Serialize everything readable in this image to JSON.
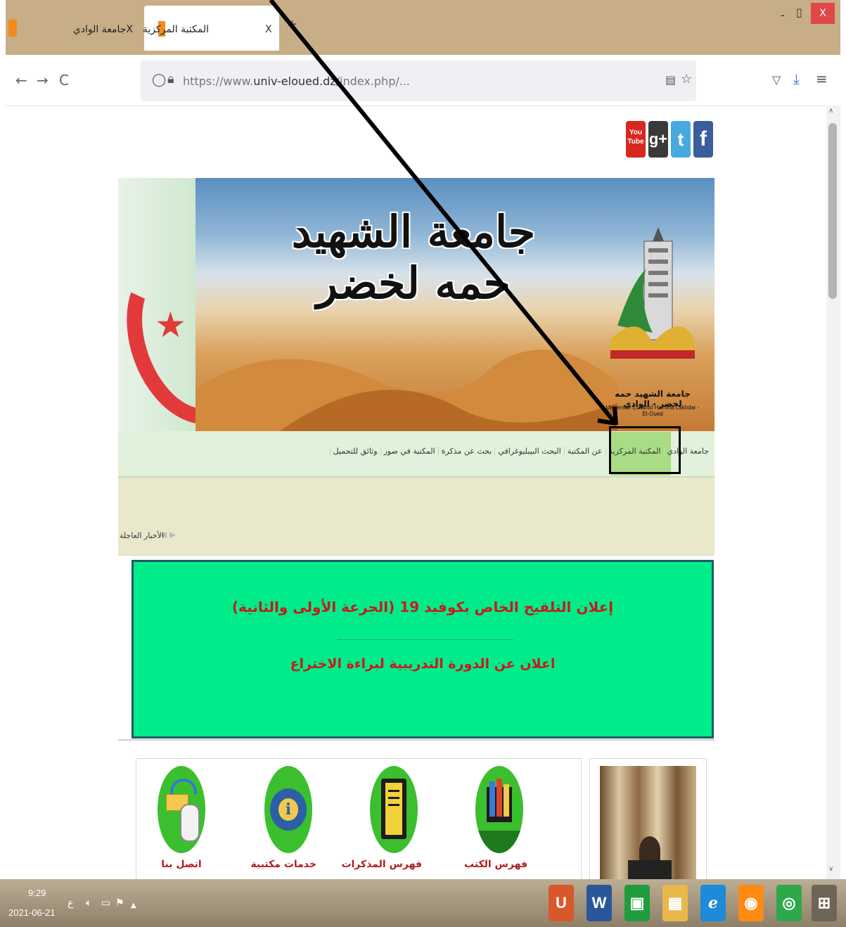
{
  "browser": {
    "tabs": [
      {
        "title": "Xجامعة الوادي",
        "active": false
      },
      {
        "title": "المكتبة المركزية",
        "active": true,
        "close": "X"
      }
    ],
    "new_tab": "+",
    "window_controls": {
      "minimize": "-",
      "maximize": "▯",
      "close": "X"
    },
    "nav": {
      "back": "←",
      "forward": "→",
      "reload": "C"
    },
    "url_prefix": "https://www.",
    "url_domain": "univ-eloued.dz",
    "url_path": "/index.php/...",
    "colors": {
      "titlebar": "#c7ae86",
      "close": "#e04848"
    }
  },
  "page": {
    "social": [
      {
        "name": "youtube",
        "label": "You Tube",
        "color": "#d6281f"
      },
      {
        "name": "google-plus",
        "label": "g+",
        "color": "#3a3a3a"
      },
      {
        "name": "twitter",
        "label": "t",
        "color": "#48a9e0"
      },
      {
        "name": "facebook",
        "label": "f",
        "color": "#3b5d9e"
      }
    ],
    "banner": {
      "title": "جامعة الشهيد حمه لخضر",
      "logo_ar": "جامعة الشهيد حمه لخضر - الوادي",
      "logo_fr": "Université Echahid Hamma Lakhdar - El-Oued"
    },
    "menu": [
      "جامعة الوادي",
      "المكتبة المركزية",
      "عن المكتبة",
      "البحث البيبليوغرافي",
      "بحث عن مذكرة",
      "المكتبة في صور",
      "وثائق للتحميل"
    ],
    "menu_active_index": 1,
    "ticker": {
      "label": "الأخبار العاجلة",
      "arrows": "◀ ▶"
    },
    "announcements": [
      "إعلان التلقيح الخاص بكوفيد 19 (الجرعة الأولى والثانية)",
      "اعلان عن الدورة التدريبية لبراءة الاختراع"
    ],
    "services": [
      {
        "label": "فهرس الكتب",
        "icon": "books-icon"
      },
      {
        "label": "فهرس المذكرات",
        "icon": "notebook-icon"
      },
      {
        "label": "خدمات مكتبية",
        "icon": "gear-info-icon"
      },
      {
        "label": "اتصل بنا",
        "icon": "mail-mouse-icon"
      }
    ]
  },
  "taskbar": {
    "time": "9:29",
    "date": "2021-06-21",
    "tray_lang": "ع",
    "apps": [
      {
        "name": "acrobat-app",
        "label": "U",
        "color": "#d9582b"
      },
      {
        "name": "word-app",
        "label": "W",
        "color": "#2b579a"
      },
      {
        "name": "store-app",
        "label": "▣",
        "color": "#1f9d3e"
      },
      {
        "name": "file-explorer-app",
        "label": "▦",
        "color": "#e8b84a"
      },
      {
        "name": "ie-app",
        "label": "e",
        "color": "#1e8ad9"
      },
      {
        "name": "firefox-app",
        "label": "◉",
        "color": "#ff8a14"
      },
      {
        "name": "chrome-app",
        "label": "◎",
        "color": "#2ea84a"
      },
      {
        "name": "windows-app",
        "label": "⊞",
        "color": "#6e6458"
      }
    ]
  }
}
